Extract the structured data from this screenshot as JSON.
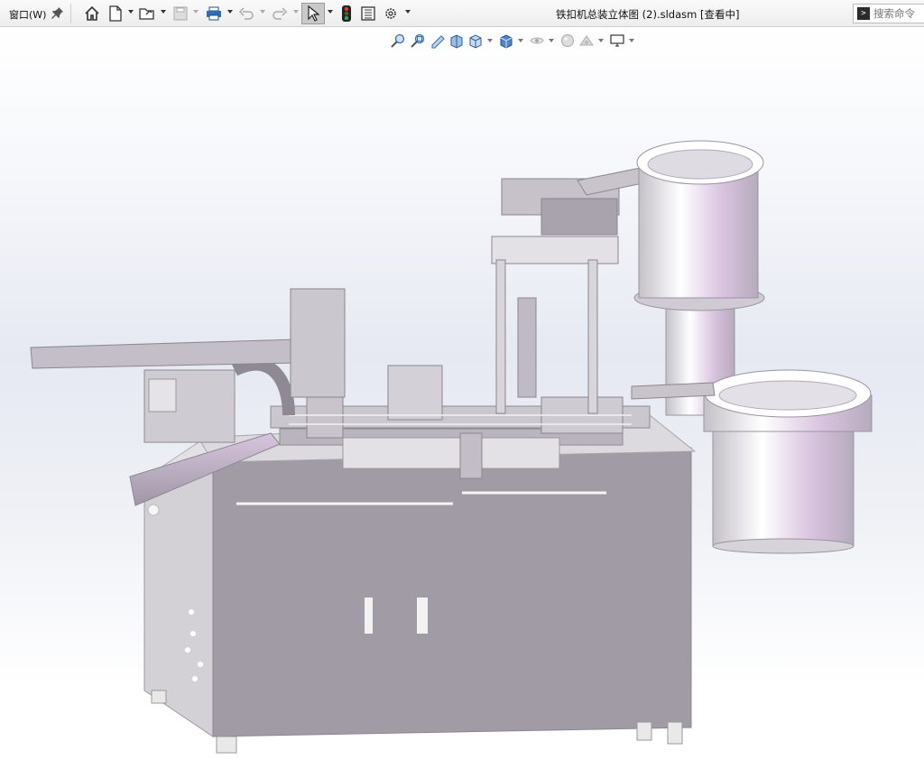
{
  "toolbar": {
    "window_menu": "窗口(W)",
    "document_title": "铁扣机总装立体图 (2).sldasm [查看中]",
    "search_placeholder": "搜索命令",
    "icons": [
      "pin-icon",
      "home-icon",
      "new-document-icon",
      "open-folder-icon",
      "save-icon",
      "print-icon",
      "undo-icon",
      "redo-icon",
      "select-arrow-icon",
      "traffic-light-icon",
      "file-properties-icon",
      "options-gear-icon"
    ]
  },
  "heads_up_toolbar": {
    "icons": [
      "zoom-to-fit-icon",
      "zoom-area-icon",
      "previous-view-icon",
      "section-view-icon",
      "view-orientation-icon",
      "display-style-icon",
      "hide-show-items-icon",
      "edit-appearance-icon",
      "apply-scene-icon",
      "view-settings-icon"
    ]
  },
  "viewport": {
    "model_description": "assembly-3d-model",
    "colors": {
      "metal": "#b8b3bb",
      "accent": "#d6c6dc",
      "shadow": "#8f8a93"
    }
  }
}
